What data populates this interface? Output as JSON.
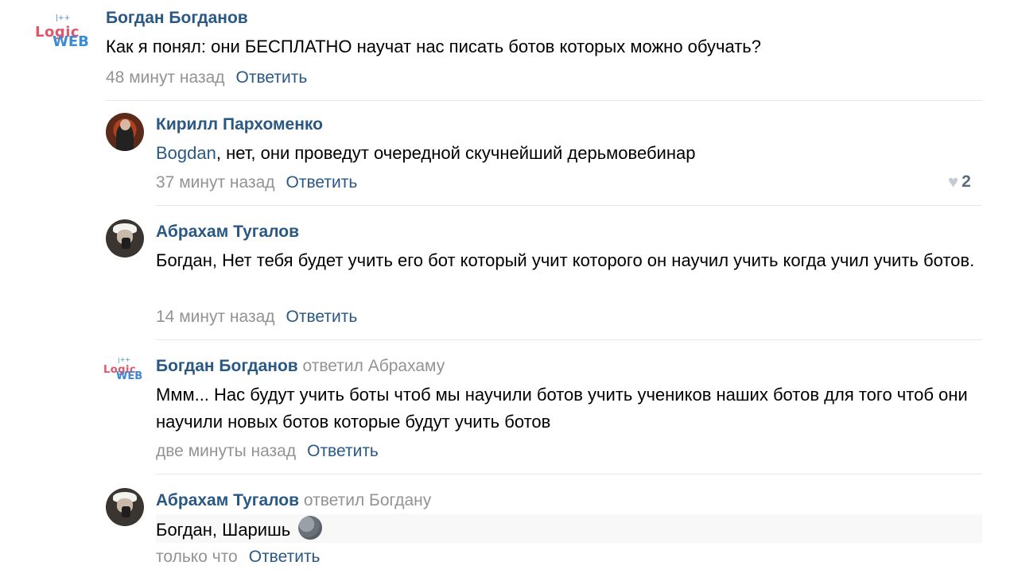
{
  "comments": [
    {
      "author": "Богдан Богданов",
      "replied_to": "",
      "text": "Как я понял: они БЕСПЛАТНО научат нас писать ботов которых можно обучать?",
      "time": "48 минут назад",
      "reply_label": "Ответить",
      "logo": {
        "line1": "Logic",
        "line2": "WEB",
        "plus": "|++"
      }
    },
    {
      "author": "Кирилл Пархоменко",
      "replied_to": "",
      "mention": "Bogdan",
      "text": ", нет, они проведут очередной скучнейший дерьмовебинар",
      "time": "37 минут назад",
      "reply_label": "Ответить",
      "likes": "2"
    },
    {
      "author": "Абрахам Тугалов",
      "replied_to": "",
      "text": "Богдан, Нет тебя будет учить его бот который учит которого он научил учить когда учил учить ботов.",
      "time": "14 минут назад",
      "reply_label": "Ответить"
    },
    {
      "author": "Богдан Богданов",
      "replied_to": "ответил Абрахаму",
      "text": "Ммм... Нас будут учить боты чтоб мы научили ботов учить учеников наших ботов для того чтоб они научили новых ботов которые будут учить ботов",
      "time": "две минуты назад",
      "reply_label": "Ответить",
      "logo": {
        "line1": "Logic",
        "line2": "WEB",
        "plus": "|++"
      }
    },
    {
      "author": "Абрахам Тугалов",
      "replied_to": "ответил Богдану",
      "text": "Богдан, Шаришь",
      "time": "только что",
      "reply_label": "Ответить"
    }
  ],
  "colors": {
    "link": "#2a5885",
    "meta": "#939393",
    "divider": "#e7e8ec"
  },
  "icons": {
    "like": "heart-icon",
    "emoji": "moon-emoji-icon"
  }
}
